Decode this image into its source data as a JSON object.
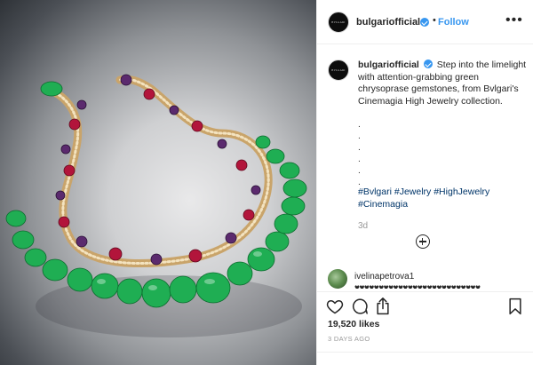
{
  "post": {
    "image_alt": "Bvlgari Cinemagia necklace",
    "colors": {
      "link_blue": "#3897f0",
      "hashtag_blue": "#003569",
      "chrysoprase_green": "#1fae53",
      "rubellite": "#b2153b",
      "amethyst": "#5b2a6e"
    }
  },
  "header": {
    "avatar_text": "BVLGARI",
    "username": "bulgariofficial",
    "dot": "•",
    "follow_label": "Follow",
    "more_label": "•••"
  },
  "caption": {
    "username": "bulgariofficial",
    "text": "Step into the limelight with attention-grabbing green chrysoprase gemstones, from Bvlgari's Cinemagia High Jewelry collection.",
    "dots": [
      ".",
      ".",
      ".",
      ".",
      ".",
      "."
    ],
    "hashtags": [
      "#Bvlgari",
      "#Jewelry",
      "#HighJewelry",
      "#Cinemagia"
    ],
    "time_ago": "3d"
  },
  "comment": {
    "username": "ivelinapetrova1",
    "text": "♥♥♥♥♥♥♥♥♥♥♥♥♥♥♥♥♥♥♥♥♥♥♥♥♥♥"
  },
  "actions": {
    "icons": [
      "heart-icon",
      "comment-icon",
      "share-icon",
      "save-icon"
    ]
  },
  "likes": "19,520 likes",
  "date": "3 DAYS AGO"
}
